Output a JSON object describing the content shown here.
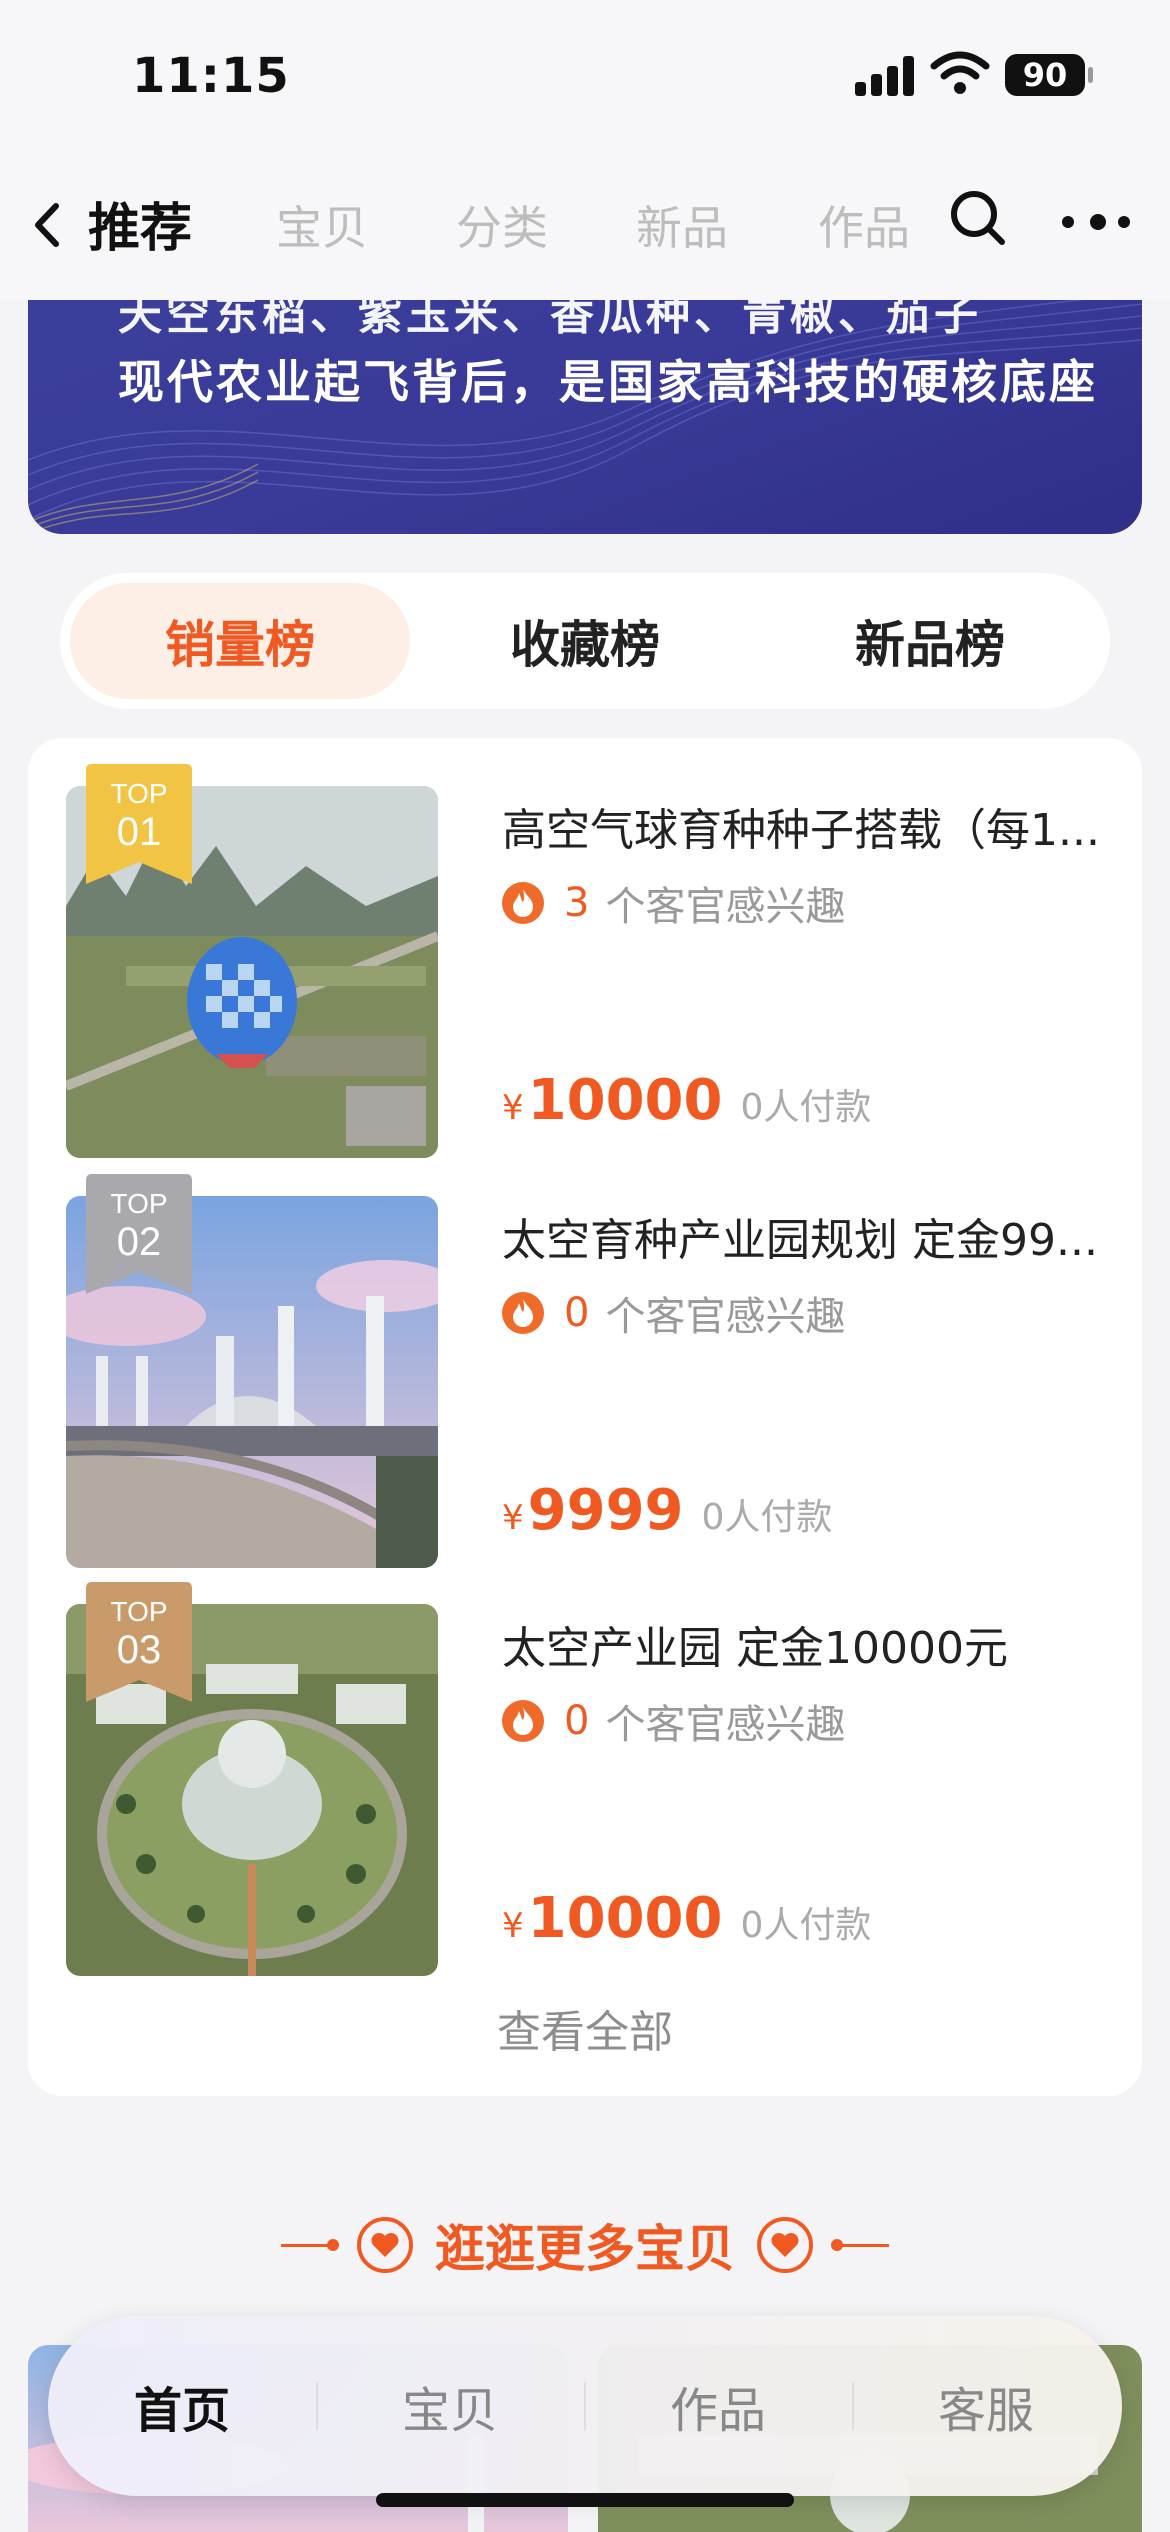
{
  "status_bar": {
    "time": "11:15",
    "battery": "90"
  },
  "nav": {
    "title": "推荐",
    "tabs": [
      "宝贝",
      "分类",
      "新品",
      "作品"
    ]
  },
  "banner": {
    "partial_line": "天空东稻、紫玉米、香瓜种、青椒、茄子",
    "headline": "现代农业起飞背后，是国家高科技的硬核底座"
  },
  "rank_tabs": {
    "items": [
      "销量榜",
      "收藏榜",
      "新品榜"
    ],
    "active": "销量榜"
  },
  "ranking": {
    "items": [
      {
        "top_label": "TOP",
        "rank": "01",
        "title": "高空气球育种种子搭载（每1...",
        "interest_count": "3",
        "interest_text": "个客官感兴趣",
        "currency": "¥",
        "price": "10000",
        "paid": "0人付款",
        "ribbon_color": "#f2c443"
      },
      {
        "top_label": "TOP",
        "rank": "02",
        "title": "太空育种产业园规划 定金99...",
        "interest_count": "0",
        "interest_text": "个客官感兴趣",
        "currency": "¥",
        "price": "9999",
        "paid": "0人付款",
        "ribbon_color": "#a9a9ad"
      },
      {
        "top_label": "TOP",
        "rank": "03",
        "title": "太空产业园 定金10000元",
        "interest_count": "0",
        "interest_text": "个客官感兴趣",
        "currency": "¥",
        "price": "10000",
        "paid": "0人付款",
        "ribbon_color": "#c99a6a"
      }
    ],
    "view_all": "查看全部"
  },
  "more_section": {
    "title": "逛逛更多宝贝"
  },
  "tab_bar": {
    "items": [
      "首页",
      "宝贝",
      "作品",
      "客服"
    ],
    "active": "首页"
  },
  "colors": {
    "accent": "#f05a22",
    "banner": "#3a3a98"
  }
}
